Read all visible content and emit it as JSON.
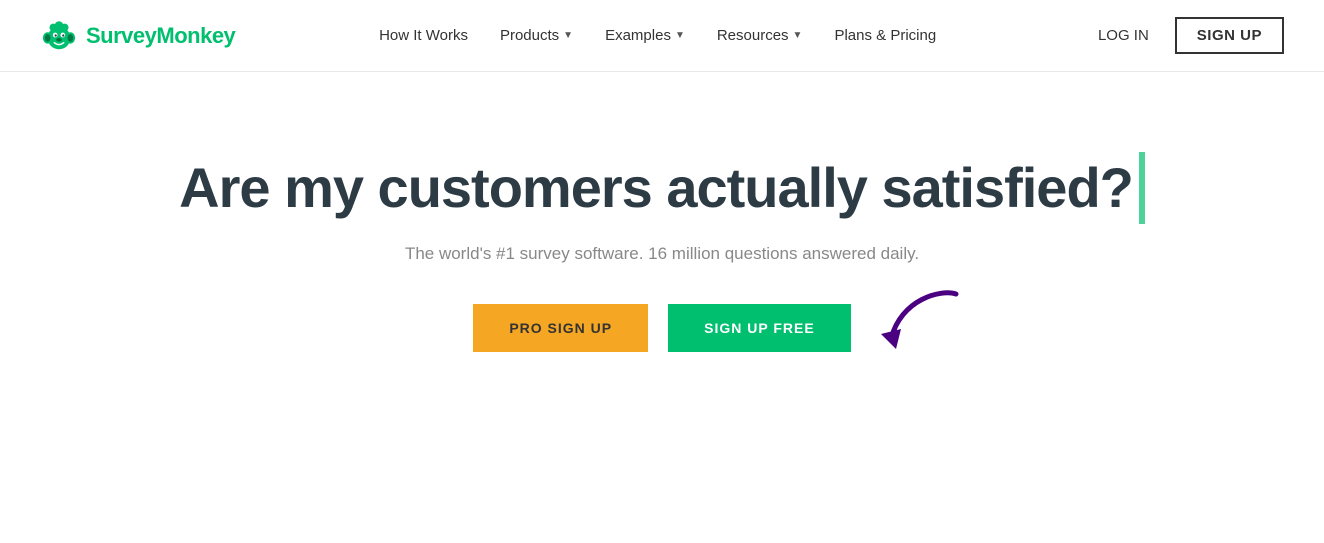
{
  "brand": {
    "name": "SurveyMonkey",
    "logo_alt": "SurveyMonkey logo"
  },
  "nav": {
    "links": [
      {
        "label": "How It Works",
        "has_dropdown": false
      },
      {
        "label": "Products",
        "has_dropdown": true
      },
      {
        "label": "Examples",
        "has_dropdown": true
      },
      {
        "label": "Resources",
        "has_dropdown": true
      },
      {
        "label": "Plans & Pricing",
        "has_dropdown": false
      }
    ],
    "login_label": "LOG IN",
    "signup_label": "SIGN UP"
  },
  "hero": {
    "heading": "Are my customers actually satisfied?",
    "subtext": "The world's #1 survey software. 16 million questions answered daily.",
    "btn_pro": "PRO SIGN UP",
    "btn_free": "SIGN UP FREE"
  }
}
